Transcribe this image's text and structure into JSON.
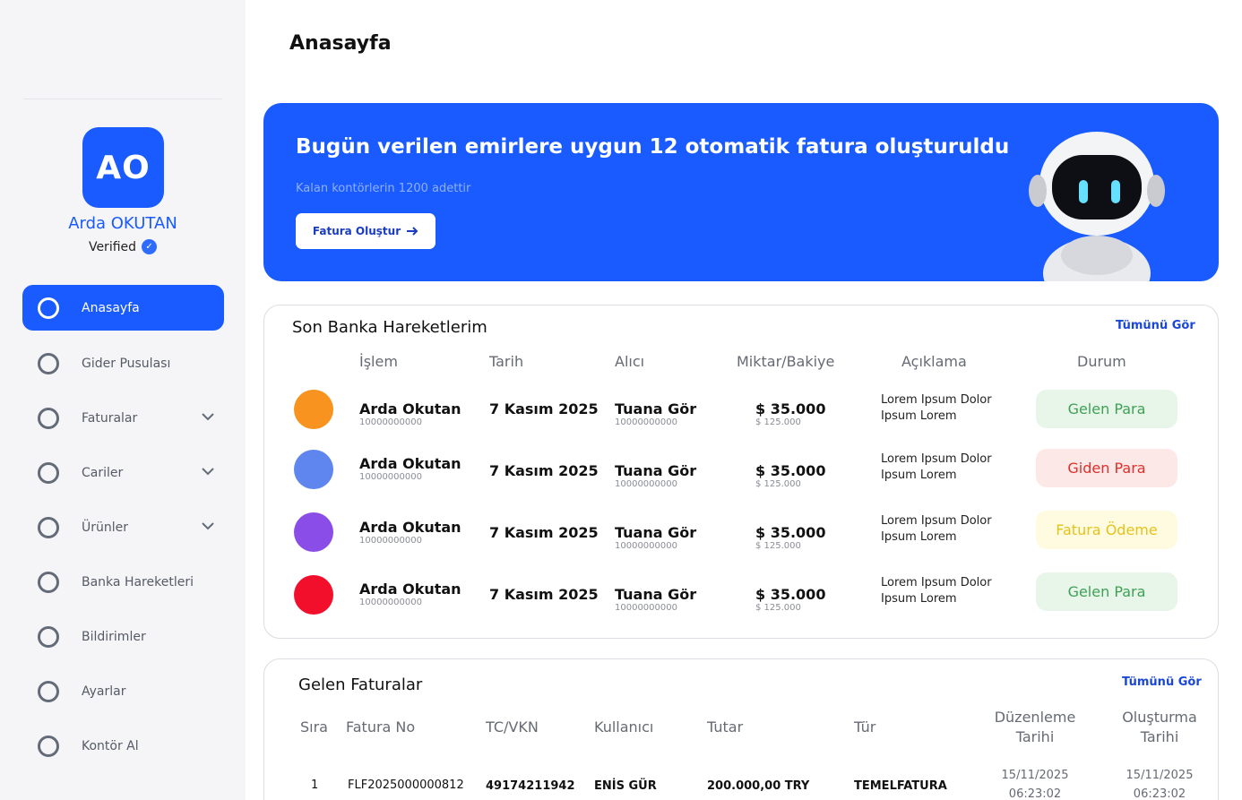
{
  "sidebar": {
    "avatar_initials": "AO",
    "user_name": "Arda OKUTAN",
    "verified_label": "Verified",
    "items": [
      {
        "label": "Anasayfa",
        "active": true,
        "expandable": false
      },
      {
        "label": "Gider Pusulası",
        "active": false,
        "expandable": false
      },
      {
        "label": "Faturalar",
        "active": false,
        "expandable": true
      },
      {
        "label": "Cariler",
        "active": false,
        "expandable": true
      },
      {
        "label": "Ürünler",
        "active": false,
        "expandable": true
      },
      {
        "label": "Banka Hareketleri",
        "active": false,
        "expandable": false
      },
      {
        "label": "Bildirimler",
        "active": false,
        "expandable": false
      },
      {
        "label": "Ayarlar",
        "active": false,
        "expandable": false
      },
      {
        "label": "Kontör Al",
        "active": false,
        "expandable": false
      }
    ]
  },
  "page": {
    "title": "Anasayfa"
  },
  "banner": {
    "title": "Bugün verilen emirlere uygun 12 otomatik fatura oluşturuldu",
    "subtitle": "Kalan kontörlerin 1200 adettir",
    "button_label": "Fatura Oluştur",
    "button_icon": "arrow-right-icon"
  },
  "bank": {
    "title": "Son Banka Hareketlerim",
    "see_all": "Tümünü Gör",
    "columns": [
      "İşlem",
      "Tarih",
      "Alıcı",
      "Miktar/Bakiye",
      "Açıklama",
      "Durum"
    ],
    "rows": [
      {
        "color": "#f7931e",
        "sender": "Arda Okutan",
        "sender_id": "10000000000",
        "date": "7 Kasım 2025",
        "receiver": "Tuana Gör",
        "receiver_id": "10000000000",
        "amount": "$ 35.000",
        "balance": "$ 125.000",
        "desc1": "Lorem Ipsum Dolor",
        "desc2": "Ipsum Lorem",
        "status": "Gelen Para",
        "status_bg": "#e8f6ea",
        "status_fg": "#3fa055"
      },
      {
        "color": "#5f86ee",
        "sender": "Arda Okutan",
        "sender_id": "10000000000",
        "date": "7 Kasım 2025",
        "receiver": "Tuana Gör",
        "receiver_id": "10000000000",
        "amount": "$ 35.000",
        "balance": "$ 125.000",
        "desc1": "Lorem Ipsum Dolor",
        "desc2": "Ipsum Lorem",
        "status": "Giden Para",
        "status_bg": "#fde8e8",
        "status_fg": "#e0302a"
      },
      {
        "color": "#8a4de8",
        "sender": "Arda Okutan",
        "sender_id": "10000000000",
        "date": "7 Kasım 2025",
        "receiver": "Tuana Gör",
        "receiver_id": "10000000000",
        "amount": "$ 35.000",
        "balance": "$ 125.000",
        "desc1": "Lorem Ipsum Dolor",
        "desc2": "Ipsum Lorem",
        "status": "Fatura Ödeme",
        "status_bg": "#fffbe0",
        "status_fg": "#e6c21a"
      },
      {
        "color": "#f20f2c",
        "sender": "Arda Okutan",
        "sender_id": "10000000000",
        "date": "7 Kasım 2025",
        "receiver": "Tuana Gör",
        "receiver_id": "10000000000",
        "amount": "$ 35.000",
        "balance": "$ 125.000",
        "desc1": "Lorem Ipsum Dolor",
        "desc2": "Ipsum Lorem",
        "status": "Gelen Para",
        "status_bg": "#e8f6ea",
        "status_fg": "#3fa055"
      }
    ]
  },
  "invoices": {
    "title": "Gelen Faturalar",
    "see_all": "Tümünü Gör",
    "columns": {
      "sira": "Sıra",
      "fatura_no": "Fatura No",
      "tc_vkn": "TC/VKN",
      "kullanici": "Kullanıcı",
      "tutar": "Tutar",
      "tur": "Tür",
      "duzenleme_1": "Düzenleme",
      "duzenleme_2": "Tarihi",
      "olusturma_1": "Oluşturma",
      "olusturma_2": "Tarihi"
    },
    "rows": [
      {
        "sira": "1",
        "fatura_no": "FLF2025000000812",
        "tc_vkn": "49174211942",
        "kullanici": "ENİS GÜR",
        "tutar": "200.000,00 TRY",
        "tur": "TEMELFATURA",
        "duzenleme_date": "15/11/2025",
        "duzenleme_time": "06:23:02",
        "olusturma_date": "15/11/2025",
        "olusturma_time": "06:23:02"
      }
    ]
  },
  "colors": {
    "accent": "#1a5bff",
    "sidebar_bg": "#f5f5f7"
  }
}
